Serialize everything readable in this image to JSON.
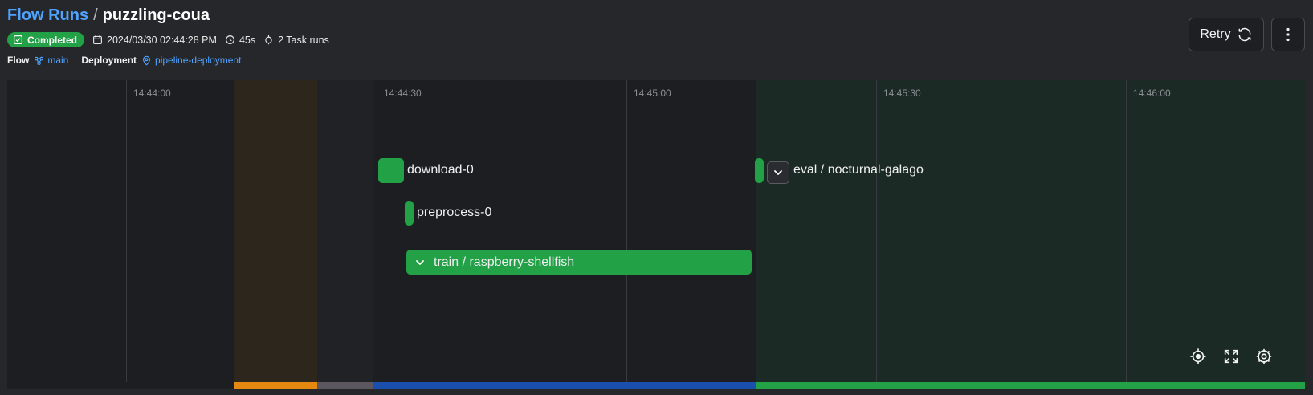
{
  "breadcrumb": {
    "parent": "Flow Runs",
    "separator": "/",
    "current": "puzzling-coua"
  },
  "run_meta": {
    "status": "Completed",
    "timestamp": "2024/03/30 02:44:28 PM",
    "duration": "45s",
    "task_runs": "2 Task runs"
  },
  "flow": {
    "label": "Flow",
    "name": "main"
  },
  "deployment": {
    "label": "Deployment",
    "name": "pipeline-deployment"
  },
  "actions": {
    "retry_label": "Retry",
    "more_icon": "more-vertical-icon"
  },
  "timeline": {
    "ticks": [
      "14:44:00",
      "14:44:30",
      "14:45:00",
      "14:45:30",
      "14:46:00"
    ],
    "nodes": {
      "download": "download-0",
      "preprocess": "preprocess-0",
      "train": "train / raspberry-shellfish",
      "eval": "eval / nocturnal-galago"
    },
    "colors": {
      "completed": "#23a147",
      "pending": "#e4880f",
      "running": "#1b4fae",
      "scheduled": "#5c5660"
    },
    "controls": [
      "recenter-icon",
      "fullscreen-icon",
      "settings-icon"
    ]
  }
}
